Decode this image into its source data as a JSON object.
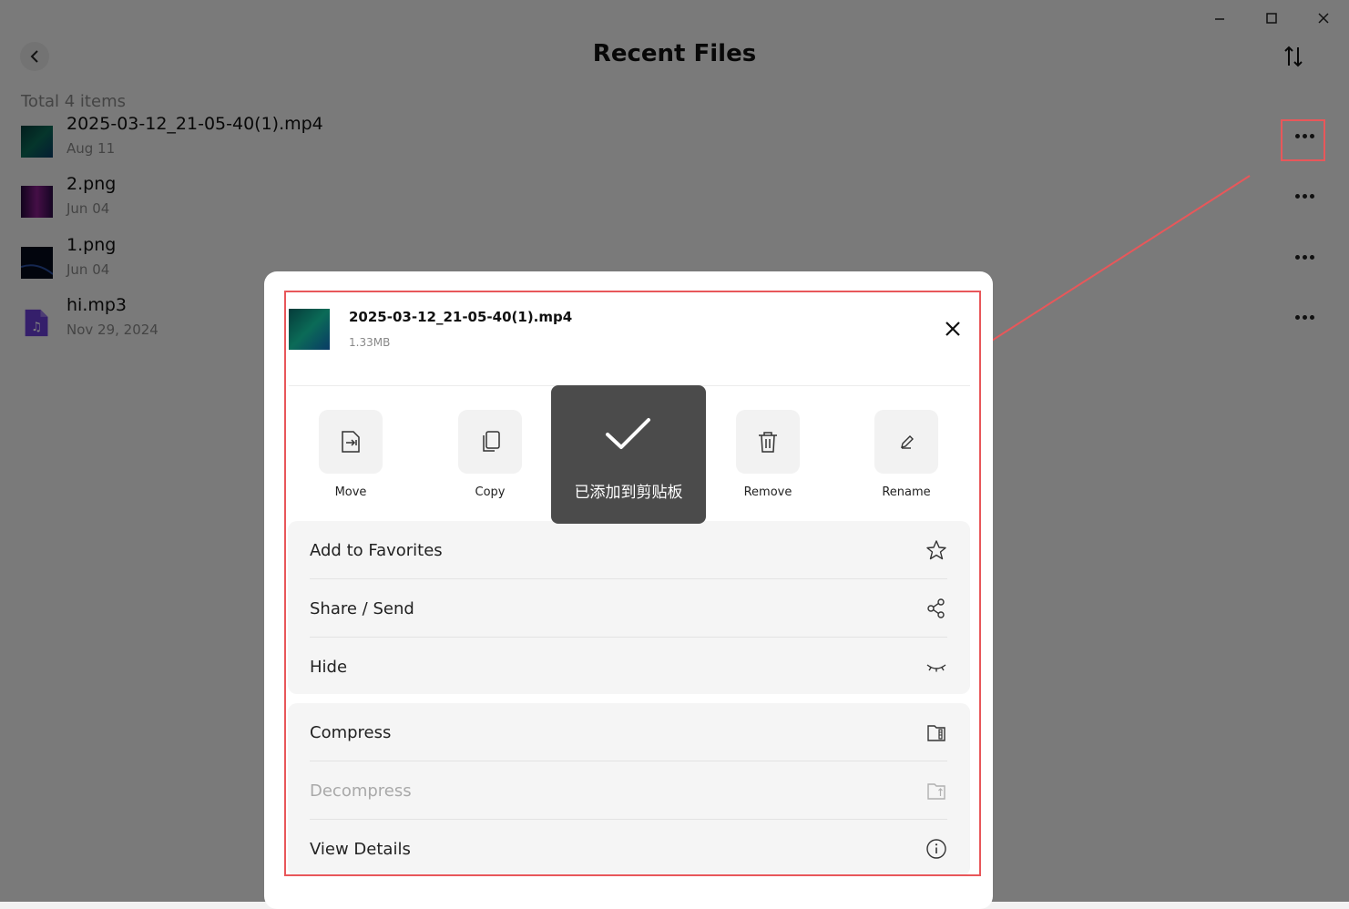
{
  "header": {
    "title": "Recent Files"
  },
  "list": {
    "total_label": "Total 4 items",
    "files": [
      {
        "name": "2025-03-12_21-05-40(1).mp4",
        "date": "Aug 11"
      },
      {
        "name": "2.png",
        "date": "Jun 04"
      },
      {
        "name": "1.png",
        "date": "Jun 04"
      },
      {
        "name": "hi.mp3",
        "date": "Nov 29, 2024"
      }
    ]
  },
  "sheet": {
    "file_name": "2025-03-12_21-05-40(1).mp4",
    "file_size": "1.33MB",
    "actions": [
      {
        "label": "Move",
        "icon": "move-icon"
      },
      {
        "label": "Copy",
        "icon": "copy-icon"
      },
      {
        "label": "Remove",
        "icon": "trash-icon"
      },
      {
        "label": "Rename",
        "icon": "pencil-icon"
      }
    ],
    "group1": [
      {
        "label": "Add to Favorites",
        "icon": "star-icon"
      },
      {
        "label": "Share / Send",
        "icon": "share-icon"
      },
      {
        "label": "Hide",
        "icon": "eye-closed-icon"
      }
    ],
    "group2": [
      {
        "label": "Compress",
        "icon": "compress-icon"
      },
      {
        "label": "Decompress",
        "icon": "decompress-icon",
        "disabled": true
      },
      {
        "label": "View Details",
        "icon": "info-icon"
      }
    ]
  },
  "toast": {
    "message": "已添加到剪贴板"
  },
  "colors": {
    "highlight": "#e8575a",
    "overlay": "rgba(0,0,0,0.5)"
  }
}
